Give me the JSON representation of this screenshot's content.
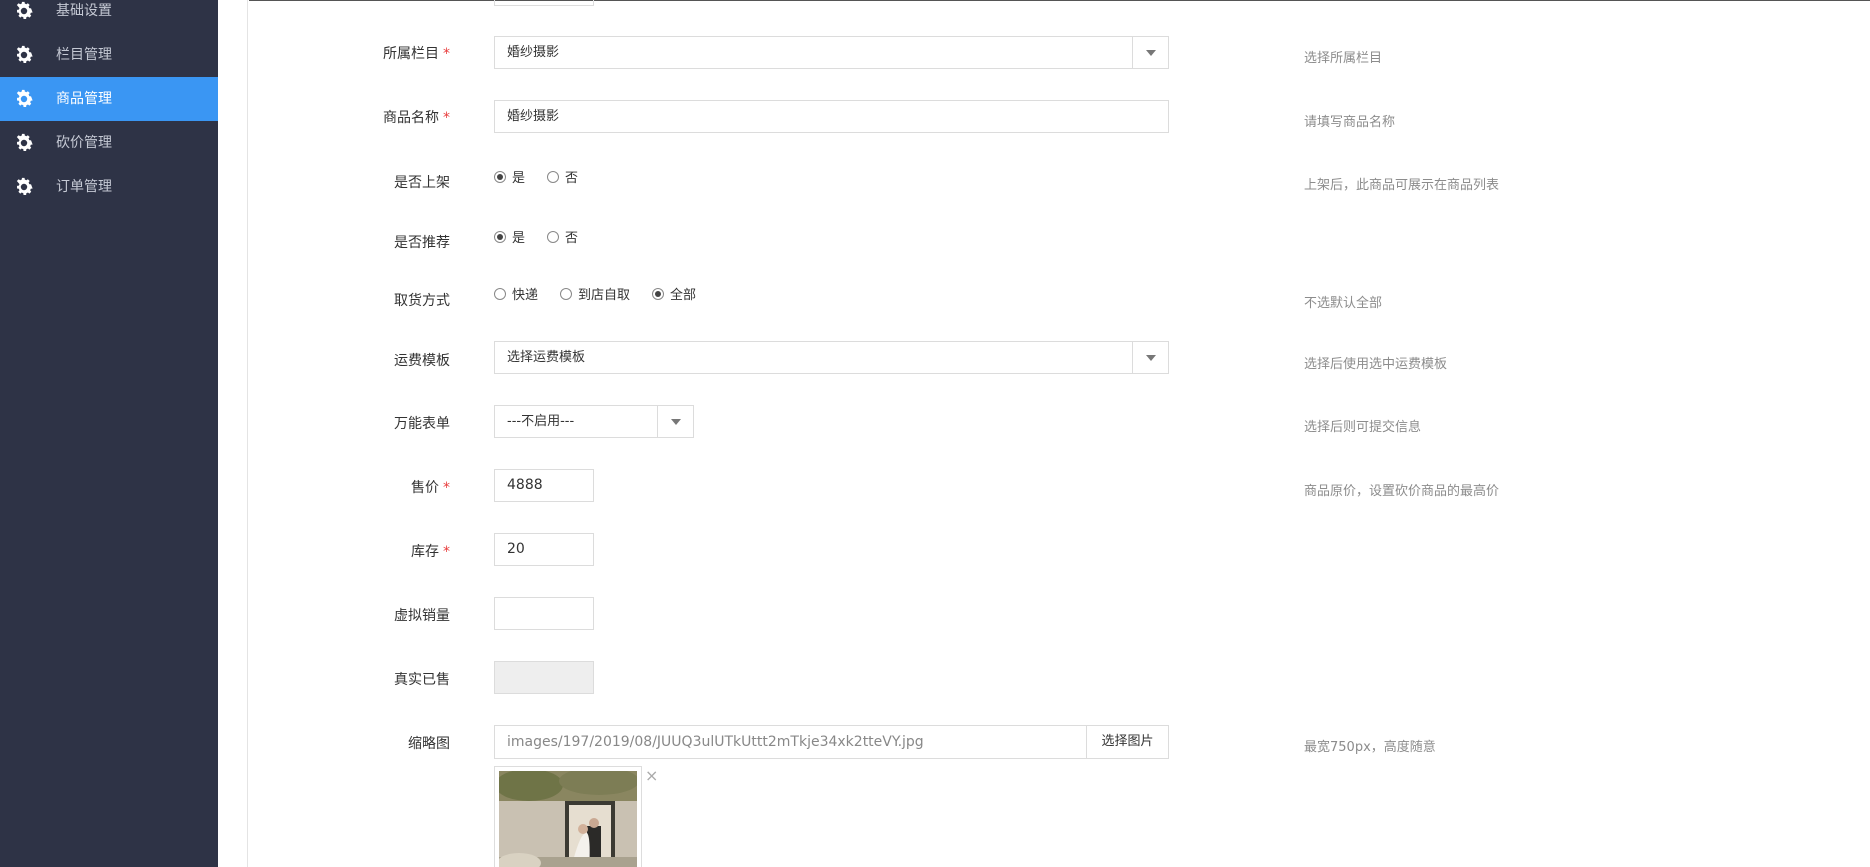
{
  "sidebar": {
    "items": [
      {
        "label": "基础设置",
        "active": false
      },
      {
        "label": "栏目管理",
        "active": false
      },
      {
        "label": "商品管理",
        "active": true
      },
      {
        "label": "砍价管理",
        "active": false
      },
      {
        "label": "订单管理",
        "active": false
      }
    ]
  },
  "form": {
    "category": {
      "label": "所属栏目",
      "value": "婚纱摄影",
      "hint": "选择所属栏目"
    },
    "name": {
      "label": "商品名称",
      "value": "婚纱摄影",
      "hint": "请填写商品名称"
    },
    "on_shelf": {
      "label": "是否上架",
      "options": [
        "是",
        "否"
      ],
      "selected": "是",
      "hint": "上架后，此商品可展示在商品列表"
    },
    "recommend": {
      "label": "是否推荐",
      "options": [
        "是",
        "否"
      ],
      "selected": "是"
    },
    "pickup": {
      "label": "取货方式",
      "options": [
        "快递",
        "到店自取",
        "全部"
      ],
      "selected": "全部",
      "hint": "不选默认全部"
    },
    "shipping": {
      "label": "运费模板",
      "value": "选择运费模板",
      "hint": "选择后使用选中运费模板"
    },
    "form_select": {
      "label": "万能表单",
      "value": "---不启用---",
      "hint": "选择后则可提交信息"
    },
    "price": {
      "label": "售价",
      "value": "4888",
      "hint": "商品原价，设置砍价商品的最高价"
    },
    "stock": {
      "label": "库存",
      "value": "20"
    },
    "virtual_sales": {
      "label": "虚拟销量",
      "value": ""
    },
    "real_sold": {
      "label": "真实已售",
      "value": ""
    },
    "thumbnail": {
      "label": "缩略图",
      "value": "images/197/2019/08/JUUQ3ulUTkUttt2mTkje34xk2tteVY.jpg",
      "button": "选择图片",
      "hint": "最宽750px，高度随意",
      "remove": "×"
    }
  },
  "colors": {
    "sidebar_bg": "#2e3346",
    "active": "#3a96f3",
    "required": "#e83b3b"
  }
}
